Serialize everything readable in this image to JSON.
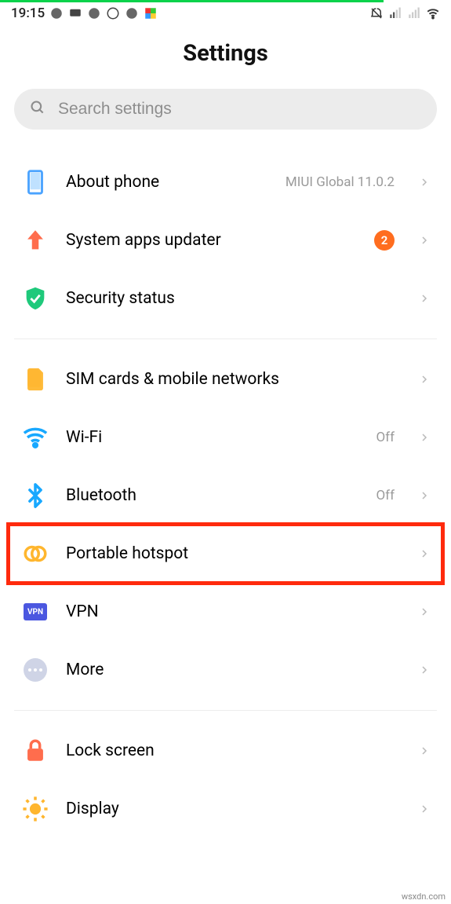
{
  "statusbar": {
    "time": "19:15"
  },
  "header": {
    "title": "Settings"
  },
  "search": {
    "placeholder": "Search settings"
  },
  "group1": {
    "about": {
      "label": "About phone",
      "value": "MIUI Global 11.0.2"
    },
    "updater": {
      "label": "System apps updater",
      "badge": "2"
    },
    "security": {
      "label": "Security status"
    }
  },
  "group2": {
    "sim": {
      "label": "SIM cards & mobile networks"
    },
    "wifi": {
      "label": "Wi-Fi",
      "value": "Off"
    },
    "bt": {
      "label": "Bluetooth",
      "value": "Off"
    },
    "hotspot": {
      "label": "Portable hotspot"
    },
    "vpn": {
      "label": "VPN",
      "badge_text": "VPN"
    },
    "more": {
      "label": "More"
    }
  },
  "group3": {
    "lock": {
      "label": "Lock screen"
    },
    "display": {
      "label": "Display"
    }
  },
  "watermark": "wsxdn.com"
}
